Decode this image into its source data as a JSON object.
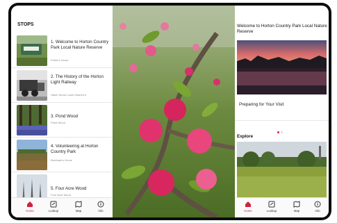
{
  "stops": {
    "heading": "STOPS",
    "items": [
      {
        "title": "1. Welcome to Horton Country Park Local Nature Reserve",
        "subtitle": "Porter's Grove"
      },
      {
        "title": "2. The History of the Horton Light Railway",
        "subtitle": "Hatch Stone Lower Warren's"
      },
      {
        "title": "3. Pond Wood",
        "subtitle": "Pond Wood"
      },
      {
        "title": "4. Volunteering at Horton Country Park",
        "subtitle": "Burnham's Grove"
      },
      {
        "title": "5. Four Acre Wood",
        "subtitle": "Four Acre Wood"
      }
    ]
  },
  "tabs": [
    {
      "label": "Home",
      "icon": "home-icon",
      "active": true
    },
    {
      "label": "Lookup",
      "icon": "lookup-icon",
      "active": false
    },
    {
      "label": "Map",
      "icon": "map-icon",
      "active": false
    },
    {
      "label": "Info",
      "icon": "info-icon",
      "active": false
    }
  ],
  "right": {
    "welcome_title": "Welcome to Horton Country Park Local Nature Reserve",
    "preparing_label": "Preparing for Your Visit",
    "explore_heading": "Explore"
  },
  "colors": {
    "accent": "#d0233e",
    "dot_inactive": "#d9d9d9"
  }
}
